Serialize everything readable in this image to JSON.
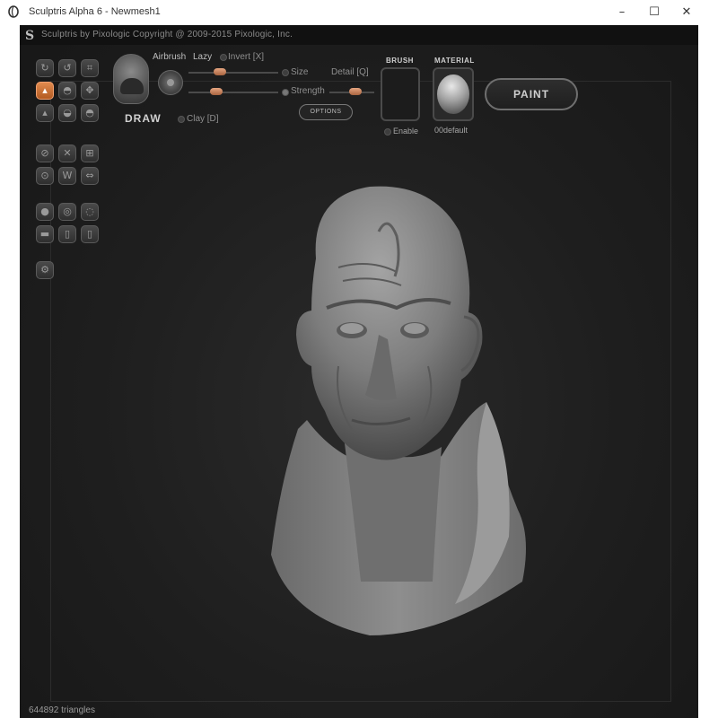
{
  "window": {
    "title": "Sculptris Alpha 6 - Newmesh1",
    "minimize_glyph": "–",
    "maximize_glyph": "☐",
    "close_glyph": "✕"
  },
  "header": {
    "logo_letter": "S",
    "text": "Sculptris by Pixologic   Copyright @ 2009-2015 Pixologic, Inc."
  },
  "tools": [
    {
      "name": "tool-rotate",
      "icon": "rotate-icon",
      "active": false
    },
    {
      "name": "tool-refresh",
      "icon": "refresh-icon",
      "active": false
    },
    {
      "name": "tool-crop",
      "icon": "crop-icon",
      "active": false
    },
    {
      "name": "tool-draw",
      "icon": "draw-brush-icon",
      "active": true
    },
    {
      "name": "tool-inflate",
      "icon": "inflate-icon",
      "active": false
    },
    {
      "name": "tool-move",
      "icon": "move-icon",
      "active": false
    },
    {
      "name": "tool-pinch",
      "icon": "pinch-icon",
      "active": false
    },
    {
      "name": "tool-smooth",
      "icon": "smooth-icon",
      "active": false
    },
    {
      "name": "tool-flatten",
      "icon": "flatten-icon",
      "active": false
    },
    {
      "name": "tool-grab",
      "icon": "grab-icon",
      "active": false
    },
    {
      "name": "tool-crease",
      "icon": "crease-icon",
      "active": false
    },
    {
      "name": "tool-grid",
      "icon": "grid-icon",
      "active": false
    },
    {
      "name": "tool-symmetry",
      "icon": "symmetry-icon",
      "active": false
    },
    {
      "name": "tool-wireframe",
      "icon": "wireframe-icon",
      "active": false
    },
    {
      "name": "tool-mirror",
      "icon": "mirror-icon",
      "active": false
    },
    {
      "name": "tool-sphere",
      "icon": "sphere-icon",
      "active": false
    },
    {
      "name": "tool-subdivide",
      "icon": "subdivide-icon",
      "active": false
    },
    {
      "name": "tool-reduce",
      "icon": "reduce-icon",
      "active": false
    },
    {
      "name": "tool-plane",
      "icon": "plane-icon",
      "active": false
    },
    {
      "name": "tool-lock",
      "icon": "lock-icon",
      "active": false
    },
    {
      "name": "tool-mask",
      "icon": "mask-icon",
      "active": false
    },
    {
      "name": "tool-settings",
      "icon": "settings-icon",
      "active": false
    }
  ],
  "brush": {
    "name": "DRAW",
    "airbrush": "Airbrush",
    "lazy": "Lazy",
    "invert": "Invert [X]",
    "size": "Size",
    "detail": "Detail [Q]",
    "strength": "Strength",
    "clay": "Clay [D]",
    "options": "OPTIONS"
  },
  "brush_panel": {
    "title": "BRUSH",
    "enable": "Enable"
  },
  "material_panel": {
    "title": "MATERIAL",
    "name": "00default"
  },
  "paint_button": "PAINT",
  "status": "644892 triangles",
  "colors": {
    "accent": "#d9743a",
    "background": "#1a1a1a",
    "sculpt": "#8a8a8a"
  }
}
